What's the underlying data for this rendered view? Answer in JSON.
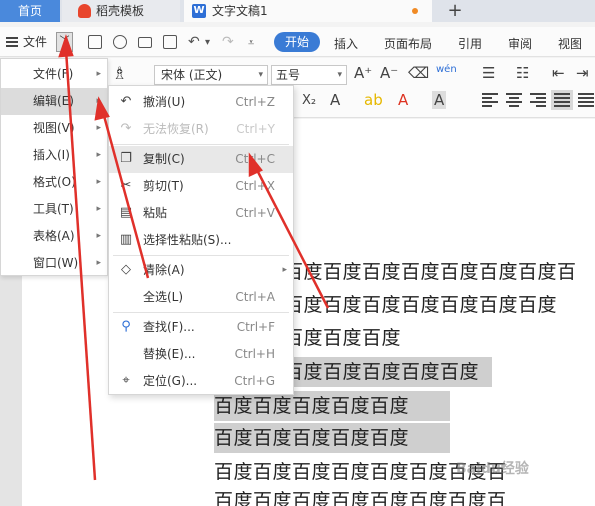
{
  "tabs": {
    "home": "首页",
    "template": "稻壳模板",
    "document": "文字文稿1",
    "new_tab": "+"
  },
  "toolbar": {
    "menu_label": "文件",
    "start_label": "开始",
    "ribbon_tabs": [
      "插入",
      "页面布局",
      "引用",
      "审阅",
      "视图"
    ]
  },
  "ribbon": {
    "font_name": "宋体 (正文)",
    "font_size": "五号"
  },
  "file_menu": {
    "items": [
      {
        "label": "文件(F)"
      },
      {
        "label": "编辑(E)"
      },
      {
        "label": "视图(V)"
      },
      {
        "label": "插入(I)"
      },
      {
        "label": "格式(O)"
      },
      {
        "label": "工具(T)"
      },
      {
        "label": "表格(A)"
      },
      {
        "label": "窗口(W)"
      }
    ]
  },
  "edit_menu": {
    "items": [
      {
        "label": "撤消(U)",
        "shortcut": "Ctrl+Z",
        "icon": "undo-icon"
      },
      {
        "label": "无法恢复(R)",
        "shortcut": "Ctrl+Y",
        "icon": "redo-icon",
        "disabled": true
      },
      {
        "label": "复制(C)",
        "shortcut": "Ctrl+C",
        "icon": "copy-icon"
      },
      {
        "label": "剪切(T)",
        "shortcut": "Ctrl+X",
        "icon": "cut-icon"
      },
      {
        "label": "粘贴",
        "shortcut": "Ctrl+V",
        "icon": "paste-icon"
      },
      {
        "label": "选择性粘贴(S)...",
        "shortcut": "",
        "icon": "paste-special-icon"
      },
      {
        "label": "清除(A)",
        "shortcut": "",
        "icon": "eraser-icon"
      },
      {
        "label": "全选(L)",
        "shortcut": "Ctrl+A",
        "icon": ""
      },
      {
        "label": "查找(F)...",
        "shortcut": "Ctrl+F",
        "icon": "search-icon"
      },
      {
        "label": "替换(E)...",
        "shortcut": "Ctrl+H",
        "icon": ""
      },
      {
        "label": "定位(G)...",
        "shortcut": "Ctrl+G",
        "icon": "locate-icon"
      }
    ]
  },
  "document": {
    "lines": [
      "百度百度百度百度百度百度百度百",
      "百度百度百度百度百度百度百度",
      "百度百度百度",
      "百度百度百度百度百度",
      "百度百度百度百度百度",
      "百度百度百度百度百度",
      "百度百度百度百度百度百度百度百",
      "百度百度百度百度百度百度百度百"
    ]
  },
  "watermark": "Baidu经验",
  "colors": {
    "accent": "#3a7bd5",
    "home_tab": "#4a89dc",
    "annotation_arrow": "#e0302a",
    "selection": "#cfcfcf"
  }
}
